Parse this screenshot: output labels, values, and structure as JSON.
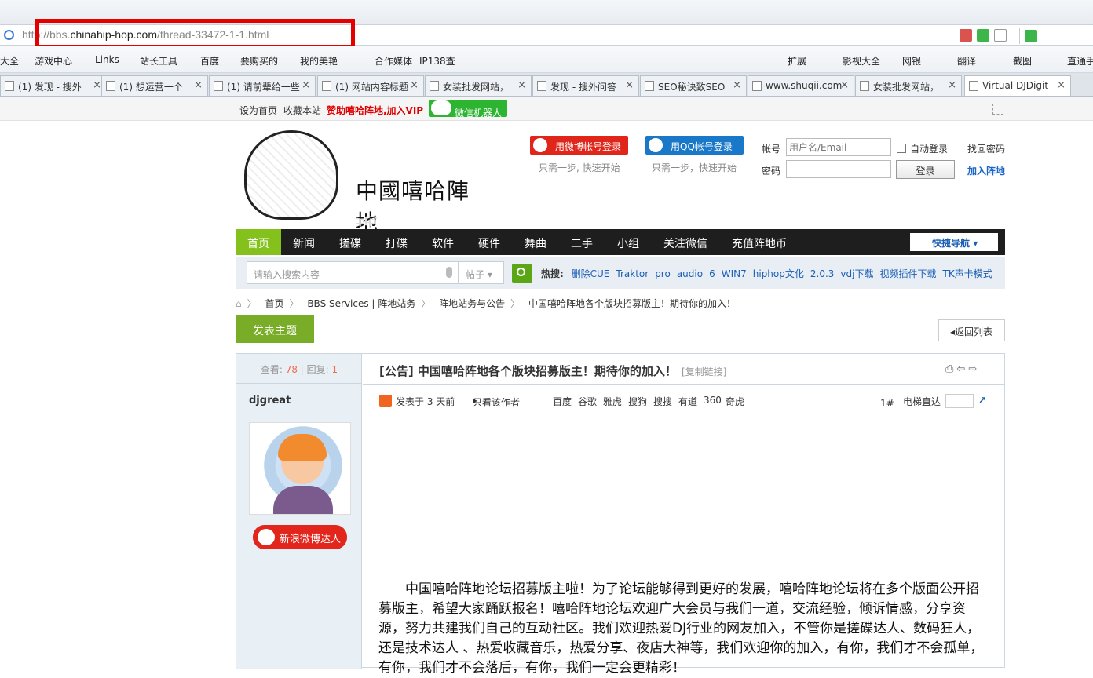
{
  "browser": {
    "url_prefix": "http://bbs.",
    "url_domain": "chinahip-hop.com",
    "url_path": "/thread-33472-1-1.html",
    "bookmarks": [
      "大全",
      "游戏中心",
      "Links",
      "站长工具",
      "百度",
      "要购买的",
      "我的美艳",
      "合作媒体",
      "IP138查"
    ],
    "right_tools": [
      "扩展",
      "影视大全",
      "网银",
      "翻译",
      "截图",
      "直通手"
    ],
    "tabs": [
      "(1) 发现 - 搜外",
      "(1) 想运营一个",
      "(1) 请前辈给一些",
      "(1) 网站内容标题",
      "女装批发网站，",
      "发现 - 搜外问答",
      "SEO秘诀致SEO",
      "www.shuqii.com",
      "女装批发网站，",
      "Virtual DJDigit"
    ]
  },
  "site": {
    "topbar": {
      "set_home": "设为首页",
      "bookmark": "收藏本站",
      "vip": "赞助嘻哈阵地,加入VIP",
      "wechat_bot": "微信机器人"
    },
    "logo_text": "中國嘻哈陣地",
    "weibo_login": "用微博帐号登录",
    "qq_login": "用QQ帐号登录",
    "login_hint": "只需一步, 快速开始",
    "login_hint2": "只需一步，快速开始",
    "login": {
      "account_label": "帐号",
      "account_placeholder": "用户名/Email",
      "auto_login": "自动登录",
      "find_pw": "找回密码",
      "pw_label": "密码",
      "login_btn": "登录",
      "join": "加入阵地"
    },
    "nav": [
      "首页",
      "新闻",
      "搓碟",
      "打碟",
      "软件",
      "硬件",
      "舞曲",
      "二手",
      "小组",
      "关注微信",
      "充值阵地币"
    ],
    "quick_nav": "快捷导航",
    "search": {
      "placeholder": "请输入搜索内容",
      "type": "帖子",
      "hot_label": "热搜:",
      "hot": [
        "删除CUE",
        "Traktor",
        "pro",
        "audio",
        "6",
        "WIN7",
        "hiphop文化",
        "2.0.3",
        "vdj下载",
        "视频插件下载",
        "TK声卡模式"
      ]
    },
    "breadcrumb": [
      "首页",
      "BBS Services | 阵地站务",
      "阵地站务与公告",
      "中国嘻哈阵地各个版块招募版主！期待你的加入！"
    ],
    "post_btn": "发表主题",
    "back_btn": "返回列表"
  },
  "thread": {
    "views_label": "查看:",
    "views": "78",
    "replies_label": "回复:",
    "replies": "1",
    "title": "[公告] 中国嘻哈阵地各个版块招募版主！期待你的加入！",
    "copy_link": "[复制链接]",
    "author": "djgreat",
    "badge": "新浪微博达人",
    "posted": "发表于 3 天前",
    "only_author": "只看该作者",
    "search_engines": [
      "百度",
      "谷歌",
      "雅虎",
      "搜狗",
      "搜搜",
      "有道",
      "360",
      "奇虎"
    ],
    "floor": "1#",
    "elevator": "电梯直达",
    "body": "中国嘻哈阵地论坛招募版主啦！为了论坛能够得到更好的发展，嘻哈阵地论坛将在多个版面公开招募版主，希望大家踊跃报名！嘻哈阵地论坛欢迎广大会员与我们一道，交流经验，倾诉情感，分享资源，努力共建我们自己的互动社区。我们欢迎热爱DJ行业的网友加入，不管你是搓碟达人、数码狂人，还是技术达人 、热爱收藏音乐，热爱分享、夜店大神等，我们欢迎你的加入，有你，我们才不会孤单，有你，我们才不会落后，有你，我们一定会更精彩！"
  }
}
